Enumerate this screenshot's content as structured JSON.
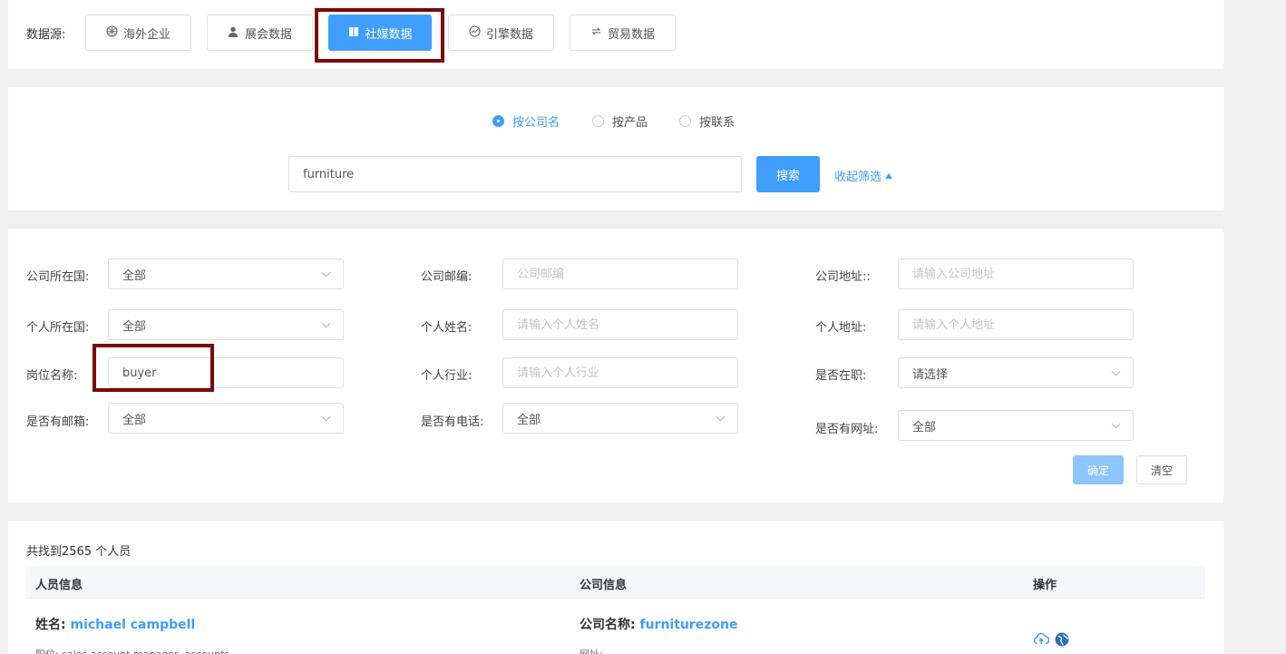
{
  "datasource": {
    "label": "数据源:",
    "buttons": [
      {
        "label": "海外企业",
        "icon": "globe-network-icon"
      },
      {
        "label": "展会数据",
        "icon": "user-icon"
      },
      {
        "label": "社媒数据",
        "icon": "book-icon"
      },
      {
        "label": "引擎数据",
        "icon": "gauge-icon"
      },
      {
        "label": "贸易数据",
        "icon": "trade-icon"
      }
    ],
    "active": "社媒数据"
  },
  "search": {
    "mode_options": [
      "按公司名",
      "按产品",
      "按联系"
    ],
    "selected_mode": "按公司名",
    "query": "furniture",
    "search_label": "搜索",
    "collapse_label": "收起筛选"
  },
  "filters": {
    "company_country": {
      "label": "公司所在国:",
      "value": "全部"
    },
    "company_zip": {
      "label": "公司邮编:",
      "placeholder": "公司邮编"
    },
    "company_address": {
      "label": "公司地址::",
      "placeholder": "请输入公司地址"
    },
    "person_country": {
      "label": "个人所在国:",
      "value": "全部"
    },
    "person_name": {
      "label": "个人姓名:",
      "placeholder": "请输入个人姓名"
    },
    "person_address": {
      "label": "个人地址:",
      "placeholder": "请输入个人地址"
    },
    "job_title": {
      "label": "岗位名称:",
      "value": "buyer"
    },
    "person_industry": {
      "label": "个人行业:",
      "placeholder": "请输入个人行业"
    },
    "employed": {
      "label": "是否在职:",
      "value": "请选择"
    },
    "has_email": {
      "label": "是否有邮箱:",
      "value": "全部"
    },
    "has_phone": {
      "label": "是否有电话:",
      "value": "全部"
    },
    "has_website": {
      "label": "是否有网址:",
      "value": "全部"
    },
    "confirm_label": "确定",
    "clear_label": "清空"
  },
  "results": {
    "count_text": "共找到2565 个人员",
    "columns": [
      "人员信息",
      "公司信息",
      "操作"
    ],
    "rows": [
      {
        "name_label": "姓名:",
        "name": "michael campbell",
        "position_text": "职位: sales account manager, accounts",
        "company_label": "公司名称:",
        "company": "furniturezone",
        "website_text": "网址: -"
      }
    ]
  },
  "colors": {
    "accent": "#409eff",
    "highlight": "#7a0a0a"
  }
}
